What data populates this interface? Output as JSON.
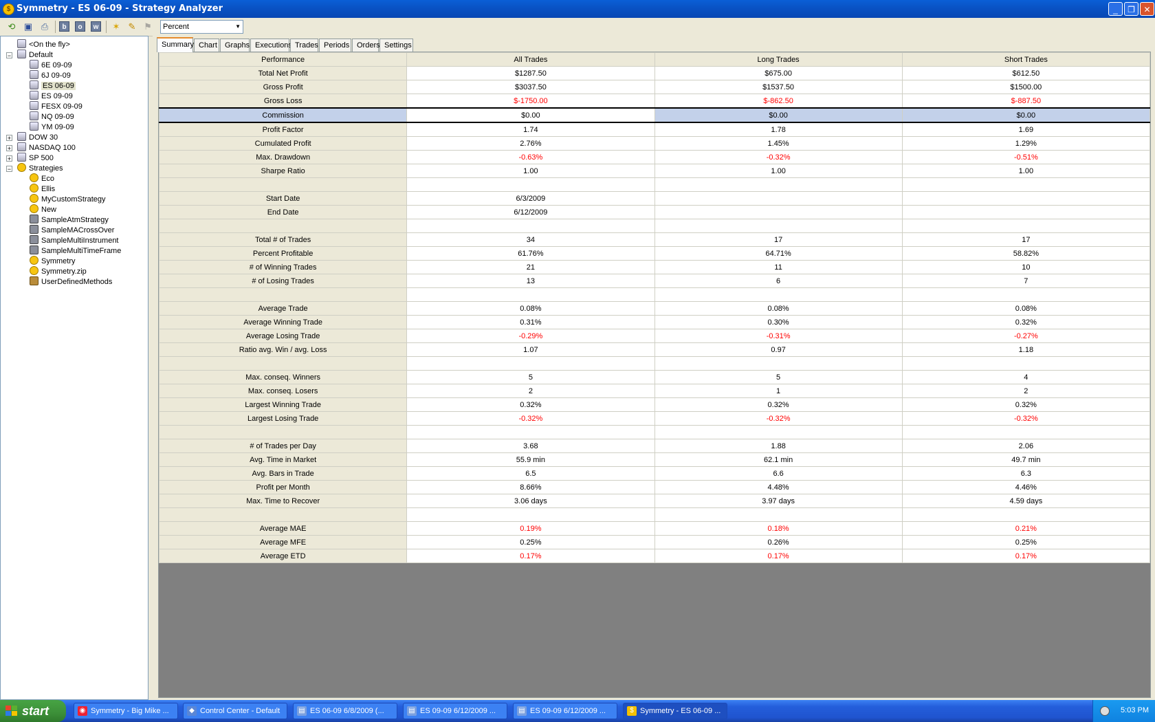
{
  "window": {
    "title": "Symmetry - ES 06-09 - Strategy Analyzer"
  },
  "toolbar": {
    "display_mode": "Percent",
    "btn_b": "b",
    "btn_o": "o",
    "btn_w": "w"
  },
  "tree": {
    "on_the_fly": "<On the fly>",
    "default": {
      "label": "Default",
      "items": [
        "6E 09-09",
        "6J 09-09",
        "ES 06-09",
        "ES 09-09",
        "FESX 09-09",
        "NQ 09-09",
        "YM 09-09"
      ]
    },
    "collapsed": [
      "DOW 30",
      "NASDAQ 100",
      "SP 500"
    ],
    "strategies": {
      "label": "Strategies",
      "items": [
        "Eco",
        "Ellis",
        "MyCustomStrategy",
        "New",
        "SampleAtmStrategy",
        "SampleMACrossOver",
        "SampleMultiInstrument",
        "SampleMultiTimeFrame",
        "Symmetry",
        "Symmetry.zip",
        "UserDefinedMethods"
      ]
    }
  },
  "tabs": [
    "Summary",
    "Chart",
    "Graphs",
    "Executions",
    "Trades",
    "Periods",
    "Orders",
    "Settings"
  ],
  "grid": {
    "headers": [
      "Performance",
      "All Trades",
      "Long Trades",
      "Short Trades"
    ],
    "rows": [
      [
        "Total Net Profit",
        "$1287.50",
        "$675.00",
        "$612.50"
      ],
      [
        "Gross Profit",
        "$3037.50",
        "$1537.50",
        "$1500.00"
      ],
      [
        "Gross Loss",
        "$-1750.00",
        "$-862.50",
        "$-887.50"
      ],
      [
        "Commission",
        "$0.00",
        "$0.00",
        "$0.00"
      ],
      [
        "Profit Factor",
        "1.74",
        "1.78",
        "1.69"
      ],
      [
        "Cumulated Profit",
        "2.76%",
        "1.45%",
        "1.29%"
      ],
      [
        "Max. Drawdown",
        "-0.63%",
        "-0.32%",
        "-0.51%"
      ],
      [
        "Sharpe Ratio",
        "1.00",
        "1.00",
        "1.00"
      ],
      [
        "",
        "",
        "",
        ""
      ],
      [
        "Start Date",
        "6/3/2009",
        "",
        ""
      ],
      [
        "End Date",
        "6/12/2009",
        "",
        ""
      ],
      [
        "",
        "",
        "",
        ""
      ],
      [
        "Total # of Trades",
        "34",
        "17",
        "17"
      ],
      [
        "Percent Profitable",
        "61.76%",
        "64.71%",
        "58.82%"
      ],
      [
        "# of Winning Trades",
        "21",
        "11",
        "10"
      ],
      [
        "# of Losing Trades",
        "13",
        "6",
        "7"
      ],
      [
        "",
        "",
        "",
        ""
      ],
      [
        "Average Trade",
        "0.08%",
        "0.08%",
        "0.08%"
      ],
      [
        "Average Winning Trade",
        "0.31%",
        "0.30%",
        "0.32%"
      ],
      [
        "Average Losing Trade",
        "-0.29%",
        "-0.31%",
        "-0.27%"
      ],
      [
        "Ratio avg. Win / avg. Loss",
        "1.07",
        "0.97",
        "1.18"
      ],
      [
        "",
        "",
        "",
        ""
      ],
      [
        "Max. conseq. Winners",
        "5",
        "5",
        "4"
      ],
      [
        "Max. conseq. Losers",
        "2",
        "1",
        "2"
      ],
      [
        "Largest Winning Trade",
        "0.32%",
        "0.32%",
        "0.32%"
      ],
      [
        "Largest Losing Trade",
        "-0.32%",
        "-0.32%",
        "-0.32%"
      ],
      [
        "",
        "",
        "",
        ""
      ],
      [
        "# of Trades per Day",
        "3.68",
        "1.88",
        "2.06"
      ],
      [
        "Avg. Time in Market",
        "55.9 min",
        "62.1 min",
        "49.7 min"
      ],
      [
        "Avg. Bars in Trade",
        "6.5",
        "6.6",
        "6.3"
      ],
      [
        "Profit per Month",
        "8.66%",
        "4.48%",
        "4.46%"
      ],
      [
        "Max. Time to Recover",
        "3.06 days",
        "3.97 days",
        "4.59 days"
      ],
      [
        "",
        "",
        "",
        ""
      ],
      [
        "Average MAE",
        "0.19%",
        "0.18%",
        "0.21%"
      ],
      [
        "Average MFE",
        "0.25%",
        "0.26%",
        "0.25%"
      ],
      [
        "Average ETD",
        "0.17%",
        "0.17%",
        "0.17%"
      ]
    ],
    "red_rows": [
      "Gross Loss",
      "Max. Drawdown",
      "Average Losing Trade",
      "Largest Losing Trade",
      "Average MAE",
      "Average ETD"
    ],
    "selected_row": "Commission",
    "negative_color": "#ff0000"
  },
  "taskbar": {
    "start_label": "start",
    "items": [
      "Symmetry - Big Mike ...",
      "Control Center - Default",
      "ES 06-09  6/8/2009 (...",
      "ES 09-09  6/12/2009 ...",
      "ES 09-09  6/12/2009 ...",
      "Symmetry - ES 06-09 ..."
    ],
    "clock": "5:03 PM"
  }
}
